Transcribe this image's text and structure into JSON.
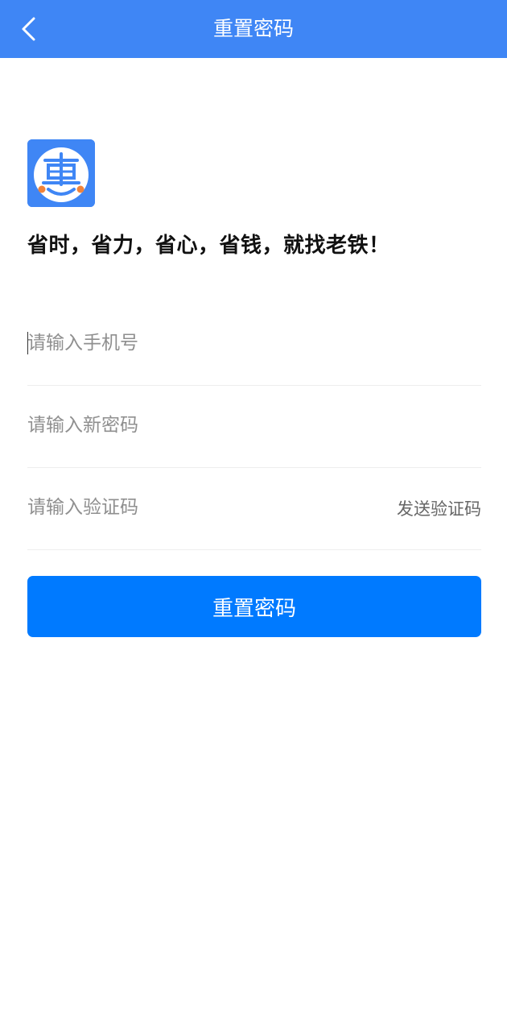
{
  "header": {
    "title": "重置密码",
    "back_icon": "chevron-left-icon",
    "background_color": "#3f86f5"
  },
  "logo": {
    "icon": "hui-logo-icon",
    "background_color": "#3f86f5",
    "accent_color": "#f0833a"
  },
  "slogan": "省时，省力，省心，省钱，就找老铁！",
  "form": {
    "phone": {
      "placeholder": "请输入手机号",
      "value": ""
    },
    "password": {
      "placeholder": "请输入新密码",
      "value": ""
    },
    "code": {
      "placeholder": "请输入验证码",
      "value": ""
    },
    "send_code_label": "发送验证码"
  },
  "submit": {
    "label": "重置密码",
    "color": "#007aff"
  }
}
